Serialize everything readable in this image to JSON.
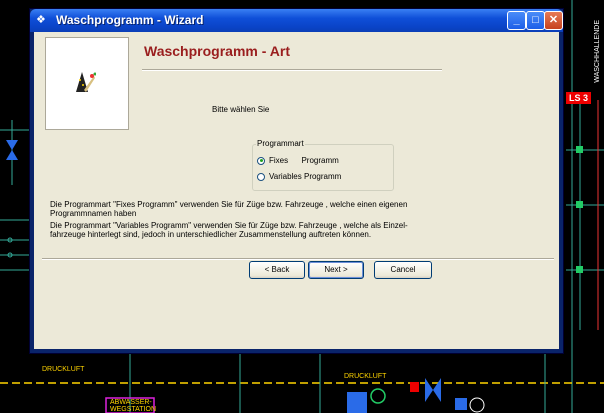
{
  "window": {
    "title": "Waschprogramm - Wizard",
    "minimize": "_",
    "maximize": "□",
    "close": "✕"
  },
  "wizard": {
    "heading": "Waschprogramm - Art",
    "prompt": "Bitte wählen Sie",
    "group_label": "Programmart",
    "options": [
      {
        "label": "Fixes      Programm",
        "selected": true
      },
      {
        "label": "Variables Programm",
        "selected": false
      }
    ],
    "description_1a": "Die Programmart \"Fixes Programm\"  verwenden Sie für  Züge bzw. Fahrzeuge , welche einen eigenen",
    "description_1b": "Programmnamen haben",
    "description_2a": "Die Programmart \"Variables Programm\"  verwenden Sie für  Züge bzw. Fahrzeuge , welche als Einzel-",
    "description_2b": "fahrzeuge hinterlegt sind, jedoch in unterschiedlicher Zusammenstellung auftreten können.",
    "back": "< Back",
    "next": "Next >",
    "cancel": "Cancel"
  },
  "background": {
    "labels": [
      "LS 3",
      "DRUCKLUFT",
      "DRUCKLUFT",
      "ABWASSER-",
      "WEGSTATION",
      "WASCHHALLENDE"
    ]
  }
}
